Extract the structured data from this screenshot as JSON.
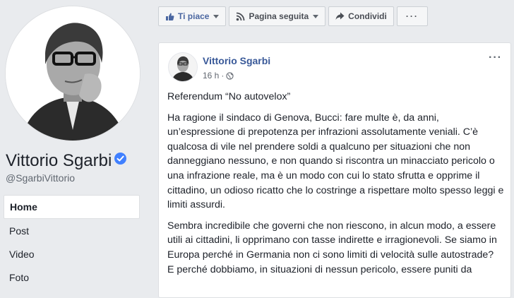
{
  "page": {
    "name": "Vittorio Sgarbi",
    "handle": "@SgarbiVittorio"
  },
  "nav": {
    "items": [
      {
        "label": "Home",
        "active": true
      },
      {
        "label": "Post",
        "active": false
      },
      {
        "label": "Video",
        "active": false
      },
      {
        "label": "Foto",
        "active": false
      }
    ]
  },
  "actions": {
    "like_label": "Ti piace",
    "follow_label": "Pagina seguita",
    "share_label": "Condividi",
    "more_label": "···"
  },
  "post": {
    "author": "Vittorio Sgarbi",
    "time": "16 h",
    "separator": "·",
    "options_label": "···",
    "title": "Referendum “No autovelox”",
    "paragraph1": "Ha ragione il sindaco di Genova, Bucci: fare multe è, da anni, un’espressione di prepotenza per infrazioni assolutamente veniali. C’è qualcosa di vile nel prendere soldi a qualcuno per situazioni che non danneggiano nessuno, e non quando si riscontra un minacciato pericolo o una infrazione reale, ma è un modo con cui lo stato sfrutta e opprime il cittadino, un odioso ricatto che lo costringe a rispettare molto spesso leggi e limiti assurdi.",
    "paragraph2": "Sembra incredibile che governi che non riescono, in alcun modo, a essere utili ai cittadini, li opprimano con tasse indirette e irragionevoli. Se siamo in Europa perché in Germania non ci sono limiti di velocità sulle autostrade?",
    "paragraph3": "E perché dobbiamo, in situazioni di nessun pericolo, essere puniti da"
  },
  "colors": {
    "link_blue": "#385898",
    "verified_blue": "#4080ff",
    "background": "#e9ebee"
  },
  "icons": {
    "verified": "verified-badge-icon",
    "like": "thumbs-up-icon",
    "follow": "rss-icon",
    "share": "share-arrow-icon",
    "privacy": "globe-icon",
    "caret": "caret-down-icon"
  }
}
